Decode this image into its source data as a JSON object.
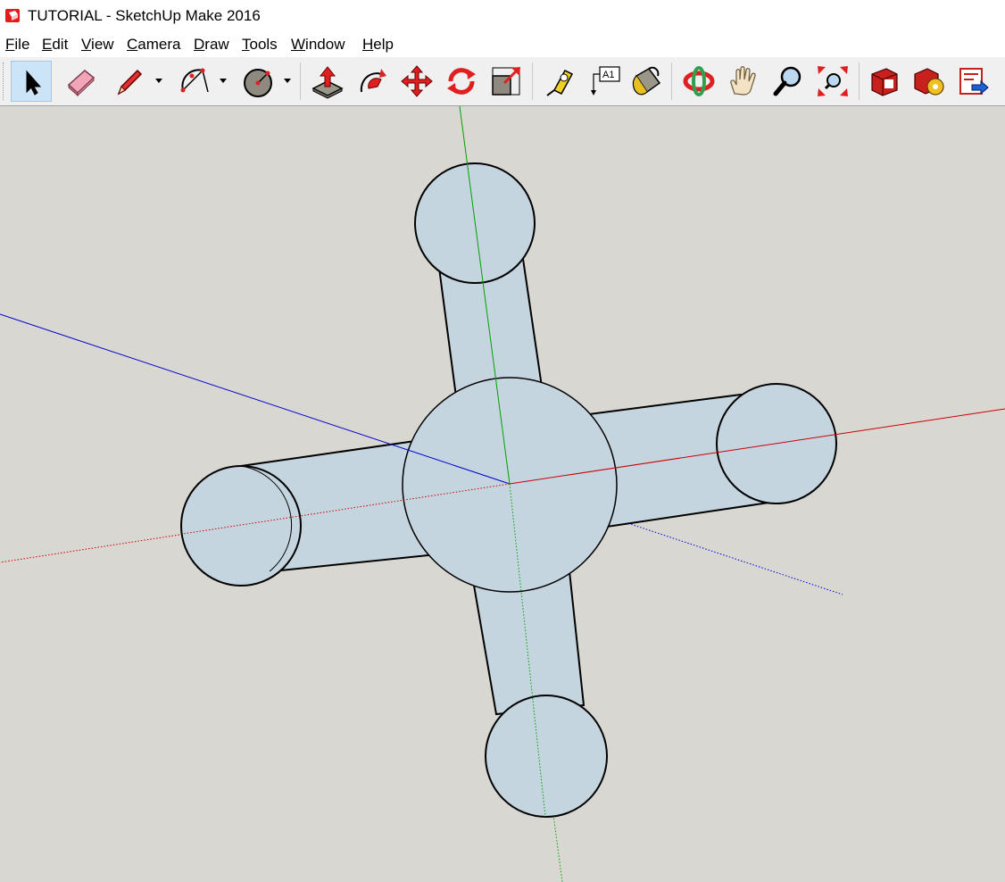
{
  "window": {
    "title": "TUTORIAL - SketchUp Make 2016"
  },
  "menu": [
    {
      "label": "File"
    },
    {
      "label": "Edit"
    },
    {
      "label": "View"
    },
    {
      "label": "Camera"
    },
    {
      "label": "Draw"
    },
    {
      "label": "Tools"
    },
    {
      "label": "Window"
    },
    {
      "label": "Help"
    }
  ],
  "toolbar": {
    "active_tool": "select-tool",
    "tools": [
      {
        "name": "select-tool",
        "icon": "arrow-cursor-icon"
      },
      {
        "name": "eraser-tool",
        "icon": "eraser-icon"
      },
      {
        "name": "line-tool",
        "icon": "pencil-icon",
        "has_dropdown": true
      },
      {
        "name": "arc-tool",
        "icon": "arc-icon",
        "has_dropdown": true
      },
      {
        "name": "shapes-tool",
        "icon": "circle-icon",
        "has_dropdown": true
      },
      {
        "name": "push-pull-tool",
        "icon": "push-pull-icon"
      },
      {
        "name": "follow-me-tool",
        "icon": "follow-me-icon"
      },
      {
        "name": "move-tool",
        "icon": "move-icon"
      },
      {
        "name": "rotate-tool",
        "icon": "rotate-icon"
      },
      {
        "name": "scale-tool",
        "icon": "scale-icon"
      },
      {
        "name": "tape-measure-tool",
        "icon": "tape-measure-icon"
      },
      {
        "name": "text-tool",
        "icon": "text-label-icon",
        "label": "A1"
      },
      {
        "name": "paint-bucket-tool",
        "icon": "paint-bucket-icon"
      },
      {
        "name": "orbit-tool",
        "icon": "orbit-icon"
      },
      {
        "name": "pan-tool",
        "icon": "hand-icon"
      },
      {
        "name": "zoom-tool",
        "icon": "magnifier-icon"
      },
      {
        "name": "zoom-extents-tool",
        "icon": "zoom-extents-icon"
      },
      {
        "name": "3d-warehouse-button",
        "icon": "warehouse-icon"
      },
      {
        "name": "extension-warehouse-button",
        "icon": "extension-icon"
      },
      {
        "name": "send-to-layout-button",
        "icon": "layout-send-icon"
      }
    ]
  },
  "scene": {
    "background_color": "#d8d7d2",
    "face_color": "#c5d5e0",
    "edge_color": "#000000",
    "axis_colors": {
      "red": "#cc0000",
      "green": "#00a000",
      "blue": "#0000cc"
    }
  }
}
